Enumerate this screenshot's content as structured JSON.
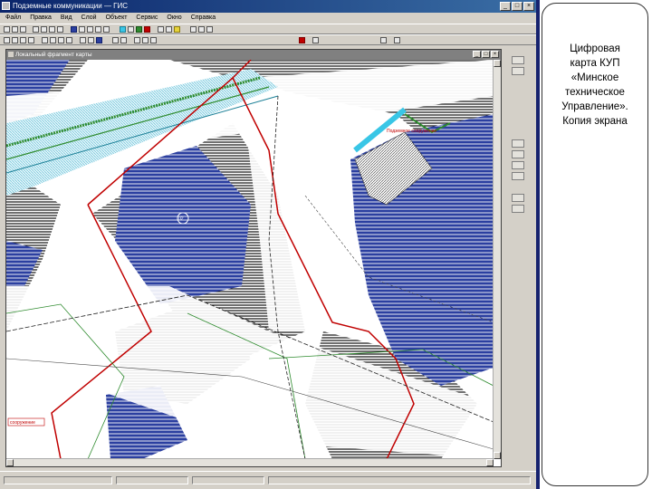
{
  "window": {
    "title": "Подземные коммуникации — ГИС",
    "min": "_",
    "max": "□",
    "close": "×"
  },
  "menu": [
    "Файл",
    "Правка",
    "Вид",
    "Слой",
    "Объект",
    "Сервис",
    "Окно",
    "Справка"
  ],
  "document": {
    "title": "Локальный фрагмент карты"
  },
  "map": {
    "labels": {
      "top_right": "Подземное сооружение",
      "left_bottom": "сооружение",
      "circle_marker": "02"
    },
    "colors": {
      "hatch_blue": "#2b3fa0",
      "boundary_red": "#c00000",
      "line_green": "#2e8b2e",
      "highlight_cyan": "#39c6e6"
    }
  },
  "caption": {
    "line1": "Цифровая",
    "line2": "карта КУП",
    "line3": "«Минское",
    "line4": "техническое",
    "line5": "Управление».",
    "line6": "Копия экрана"
  }
}
